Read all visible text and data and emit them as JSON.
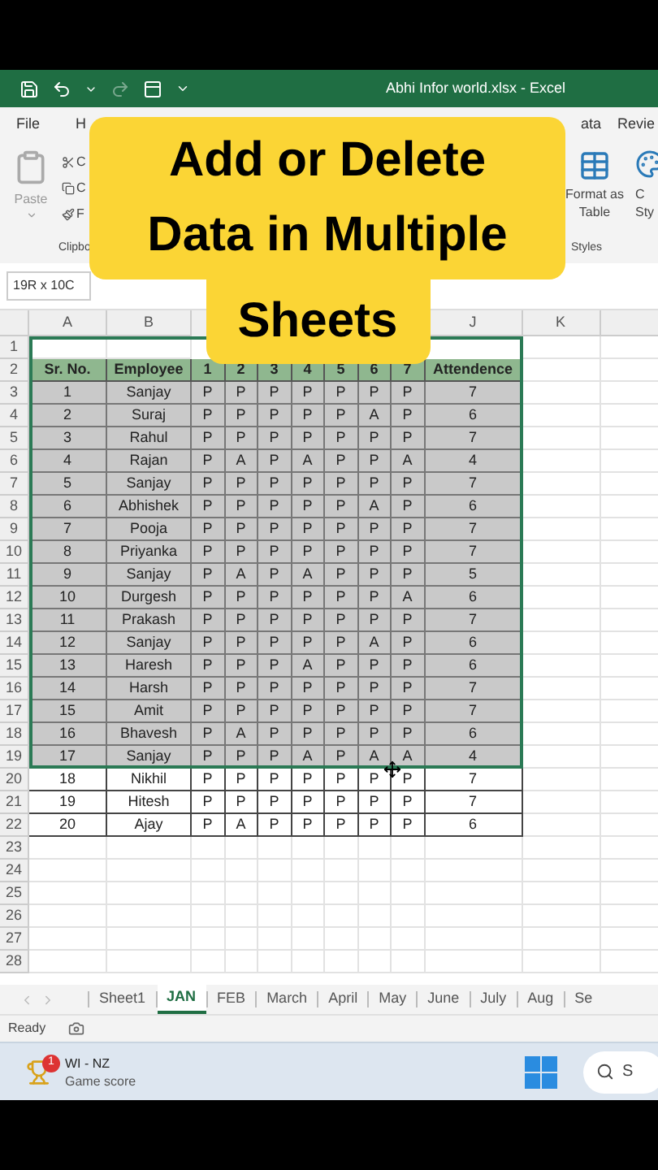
{
  "window": {
    "title": "Abhi Infor world.xlsx  -  Excel"
  },
  "ribbon": {
    "tabs": [
      "File",
      "H",
      "ata",
      "Revie"
    ],
    "paste_label": "Paste",
    "clipboard_items": [
      "C",
      "C",
      "F"
    ],
    "clipboard_label": "Clipbo",
    "format_as_table": [
      "Format as",
      "Table"
    ],
    "cell_styles": [
      "C",
      "Sty"
    ],
    "styles_label": "Styles"
  },
  "overlay": {
    "lines": [
      "Add or Delete",
      "Data in Multiple",
      "Sheets"
    ]
  },
  "name_box": "19R x 10C",
  "column_headers": [
    "A",
    "B",
    "J",
    "K"
  ],
  "row_numbers": [
    "1",
    "2",
    "3",
    "4",
    "5",
    "6",
    "7",
    "8",
    "9",
    "10",
    "11",
    "12",
    "13",
    "14",
    "15",
    "16",
    "17",
    "18",
    "19",
    "20",
    "21",
    "22",
    "23",
    "24",
    "25",
    "26",
    "27",
    "28"
  ],
  "table": {
    "header": [
      "Sr. No.",
      "Employee",
      "1",
      "2",
      "3",
      "4",
      "5",
      "6",
      "7",
      "Attendence"
    ],
    "rows": [
      {
        "selected": true,
        "cells": [
          "1",
          "Sanjay",
          "P",
          "P",
          "P",
          "P",
          "P",
          "P",
          "P",
          "7"
        ]
      },
      {
        "selected": true,
        "cells": [
          "2",
          "Suraj",
          "P",
          "P",
          "P",
          "P",
          "P",
          "A",
          "P",
          "6"
        ]
      },
      {
        "selected": true,
        "cells": [
          "3",
          "Rahul",
          "P",
          "P",
          "P",
          "P",
          "P",
          "P",
          "P",
          "7"
        ]
      },
      {
        "selected": true,
        "cells": [
          "4",
          "Rajan",
          "P",
          "A",
          "P",
          "A",
          "P",
          "P",
          "A",
          "4"
        ]
      },
      {
        "selected": true,
        "cells": [
          "5",
          "Sanjay",
          "P",
          "P",
          "P",
          "P",
          "P",
          "P",
          "P",
          "7"
        ]
      },
      {
        "selected": true,
        "cells": [
          "6",
          "Abhishek",
          "P",
          "P",
          "P",
          "P",
          "P",
          "A",
          "P",
          "6"
        ]
      },
      {
        "selected": true,
        "cells": [
          "7",
          "Pooja",
          "P",
          "P",
          "P",
          "P",
          "P",
          "P",
          "P",
          "7"
        ]
      },
      {
        "selected": true,
        "cells": [
          "8",
          "Priyanka",
          "P",
          "P",
          "P",
          "P",
          "P",
          "P",
          "P",
          "7"
        ]
      },
      {
        "selected": true,
        "cells": [
          "9",
          "Sanjay",
          "P",
          "A",
          "P",
          "A",
          "P",
          "P",
          "P",
          "5"
        ]
      },
      {
        "selected": true,
        "cells": [
          "10",
          "Durgesh",
          "P",
          "P",
          "P",
          "P",
          "P",
          "P",
          "A",
          "6"
        ]
      },
      {
        "selected": true,
        "cells": [
          "11",
          "Prakash",
          "P",
          "P",
          "P",
          "P",
          "P",
          "P",
          "P",
          "7"
        ]
      },
      {
        "selected": true,
        "cells": [
          "12",
          "Sanjay",
          "P",
          "P",
          "P",
          "P",
          "P",
          "A",
          "P",
          "6"
        ]
      },
      {
        "selected": true,
        "cells": [
          "13",
          "Haresh",
          "P",
          "P",
          "P",
          "A",
          "P",
          "P",
          "P",
          "6"
        ]
      },
      {
        "selected": true,
        "cells": [
          "14",
          "Harsh",
          "P",
          "P",
          "P",
          "P",
          "P",
          "P",
          "P",
          "7"
        ]
      },
      {
        "selected": true,
        "cells": [
          "15",
          "Amit",
          "P",
          "P",
          "P",
          "P",
          "P",
          "P",
          "P",
          "7"
        ]
      },
      {
        "selected": true,
        "cells": [
          "16",
          "Bhavesh",
          "P",
          "A",
          "P",
          "P",
          "P",
          "P",
          "P",
          "6"
        ]
      },
      {
        "selected": true,
        "cells": [
          "17",
          "Sanjay",
          "P",
          "P",
          "P",
          "A",
          "P",
          "A",
          "A",
          "4"
        ]
      },
      {
        "selected": false,
        "cells": [
          "18",
          "Nikhil",
          "P",
          "P",
          "P",
          "P",
          "P",
          "P",
          "P",
          "7"
        ]
      },
      {
        "selected": false,
        "cells": [
          "19",
          "Hitesh",
          "P",
          "P",
          "P",
          "P",
          "P",
          "P",
          "P",
          "7"
        ]
      },
      {
        "selected": false,
        "cells": [
          "20",
          "Ajay",
          "P",
          "A",
          "P",
          "P",
          "P",
          "P",
          "P",
          "6"
        ]
      }
    ]
  },
  "sheet_tabs": [
    {
      "label": "Sheet1",
      "selected": false
    },
    {
      "label": "JAN",
      "selected": true
    },
    {
      "label": "FEB",
      "selected": false
    },
    {
      "label": "March",
      "selected": false
    },
    {
      "label": "April",
      "selected": false
    },
    {
      "label": "May",
      "selected": false
    },
    {
      "label": "June",
      "selected": false
    },
    {
      "label": "July",
      "selected": false
    },
    {
      "label": "Aug",
      "selected": false
    },
    {
      "label": "Se",
      "selected": false
    }
  ],
  "status_bar": {
    "text": "Ready"
  },
  "taskbar": {
    "widget": {
      "badge": "1",
      "title": "WI - NZ",
      "subtitle": "Game score"
    },
    "search": "S"
  }
}
